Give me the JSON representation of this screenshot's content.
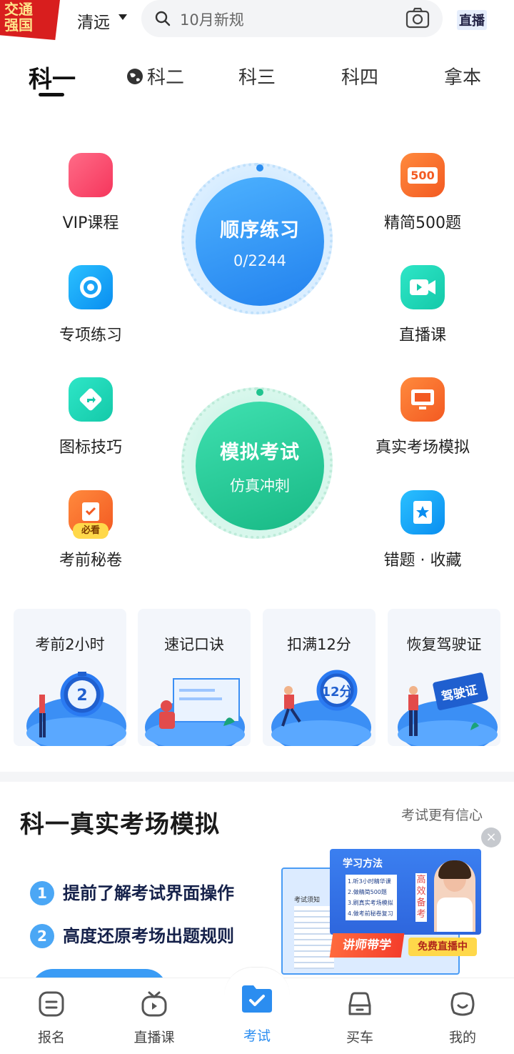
{
  "header": {
    "badge_line1": "交通",
    "badge_line2": "强国",
    "city": "清远",
    "search_placeholder": "10月新规",
    "live_label": "直播"
  },
  "tabs": [
    {
      "label": "科一",
      "active": true
    },
    {
      "label": "科二",
      "active": false
    },
    {
      "label": "科三",
      "active": false
    },
    {
      "label": "科四",
      "active": false
    },
    {
      "label": "拿本",
      "active": false
    }
  ],
  "features": {
    "vip": "VIP课程",
    "special": "专项练习",
    "icons": "图标技巧",
    "secret": "考前秘卷",
    "secret_tag": "必看",
    "select500": "精简500题",
    "select500_tag": "500",
    "live": "直播课",
    "real_sim": "真实考场模拟",
    "mistakes": "错题 · 收藏"
  },
  "circles": {
    "practice_title": "顺序练习",
    "practice_progress": "0/2244",
    "exam_title": "模拟考试",
    "exam_sub": "仿真冲刺"
  },
  "cards": [
    {
      "title": "考前2小时",
      "art_text": "2"
    },
    {
      "title": "速记口诀",
      "art_text": ""
    },
    {
      "title": "扣满12分",
      "art_text": "12分"
    },
    {
      "title": "恢复驾驶证",
      "art_text": "驾驶证"
    }
  ],
  "sim": {
    "title": "科一真实考场模拟",
    "hint": "考试更有信心",
    "points": [
      {
        "num": "1",
        "text": "提前了解考试界面操作"
      },
      {
        "num": "2",
        "text": "高度还原考场出题规则"
      }
    ],
    "close": "×",
    "promo": {
      "header": "学习方法",
      "doc_title": "考试须知",
      "steps": [
        "1.听3小时精华课",
        "2.做精简500题",
        "3.刷真实考场模拟",
        "4.做考前秘卷复习"
      ],
      "side": "高效备考",
      "teacher_tag": "讲师带学",
      "live_tag": "免费直播中"
    }
  },
  "nav": [
    {
      "label": "报名",
      "active": false
    },
    {
      "label": "直播课",
      "active": false
    },
    {
      "label": "考试",
      "active": true
    },
    {
      "label": "买车",
      "active": false
    },
    {
      "label": "我的",
      "active": false
    }
  ],
  "colors": {
    "accent": "#2b8df0",
    "practice_blue": "#3a9cf5",
    "exam_green": "#2fcf9c",
    "badge_red": "#d81e1e"
  }
}
